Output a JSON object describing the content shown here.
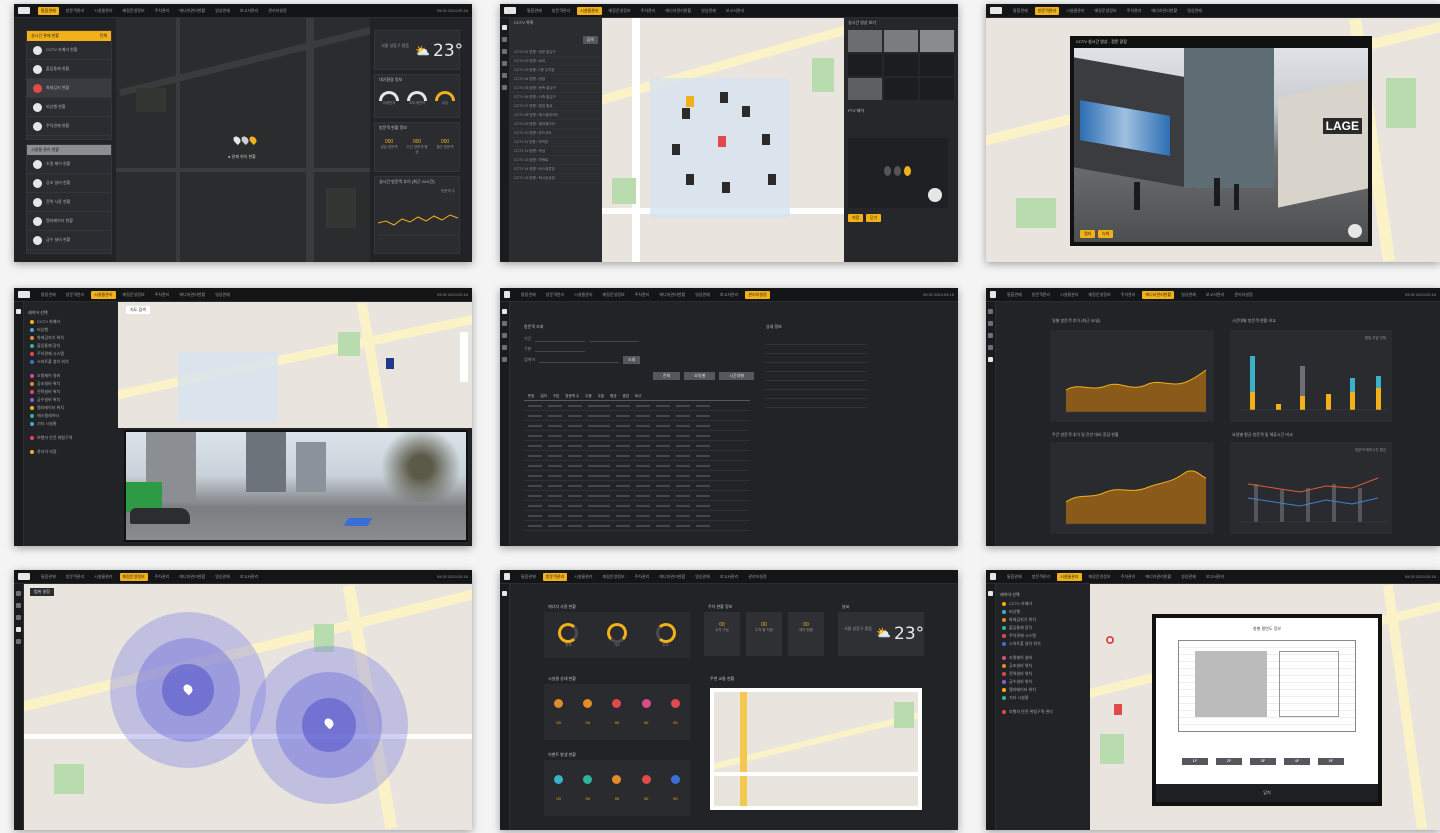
{
  "menu": [
    "통합관제",
    "방문객관리",
    "시설물관리",
    "매장운영정보",
    "주차관리",
    "에너지관리현황",
    "영상관제",
    "보고서관리",
    "관리자설정",
    "설정"
  ],
  "active_menu_index": 0,
  "top_right": "09:30 2024.05.16",
  "screen1": {
    "list1_header": "실시간 관제 현황",
    "list1_tag": "전체",
    "list1": [
      "CCTV 카메라 현황",
      "출입통제 현황",
      "화재감지 현황",
      "비상벨 현황",
      "주차관제 현황"
    ],
    "list2_header": "시설물 관리 현황",
    "list2": [
      "조명 제어 현황",
      "공조 설비 현황",
      "전력 사용 현황",
      "엘리베이터 현황",
      "급수 설비 현황"
    ],
    "map_label": "● 관제 위치 현황",
    "weather": {
      "label": "서울 성동구 맑음",
      "temp": "23°"
    },
    "gauge_title": "대기환경 정보",
    "gauges": [
      "미세먼지",
      "초미세먼지",
      "오존"
    ],
    "stats_title": "방문객 현황 정보",
    "stats": [
      {
        "value": "000",
        "label": "일일 방문객"
      },
      {
        "value": "000",
        "label": "주간 방문객 평균"
      },
      {
        "value": "000",
        "label": "월간 방문객"
      }
    ],
    "trend_title": "실시간 방문객 추이 (최근 24시간)",
    "trend_legend": "방문객 수"
  },
  "screen2": {
    "list_header": "CCTV 목록",
    "button": "검색",
    "rows": [
      "CCTV 01 방향 / 정문 출입구",
      "CCTV 02 방향 / 로비",
      "CCTV 03 방향 / 1층 주차장",
      "CCTV 04 방향 / 광장",
      "CCTV 05 방향 / 동측 출입구",
      "CCTV 06 방향 / 서측 출입구",
      "CCTV 07 방향 / 중앙 통로",
      "CCTV 08 방향 / 에스컬레이터",
      "CCTV 09 방향 / 엘리베이터",
      "CCTV 10 방향 / 푸드코트",
      "CCTV 11 방향 / 하역장",
      "CCTV 12 방향 / 옥상",
      "CCTV 13 방향 / 보행로",
      "CCTV 14 방향 / 버스정류장",
      "CCTV 15 방향 / 택시승강장"
    ],
    "video_title": "실시간 영상 보기",
    "control_title": "PTZ 제어",
    "buttons": [
      "저장",
      "닫기"
    ]
  },
  "screen3": {
    "popup_title": "CCTV 실시간 영상 - 정문 광장",
    "buttons": [
      "캡처",
      "녹화"
    ],
    "sign": "LAGE"
  },
  "screen4": {
    "panel_title": "레이어 선택",
    "group1": [
      "CCTV 카메라",
      "비상벨",
      "화재감지기 위치",
      "출입통제 장치",
      "주차관제 시스템",
      "스마트폴 설치 위치"
    ],
    "group2": [
      "조명제어 설비",
      "공조설비 위치",
      "전력설비 위치",
      "급수설비 위치",
      "엘리베이터 위치",
      "에스컬레이터",
      "기타 시설물"
    ],
    "group3": [
      "보행자 안전 위험구역"
    ],
    "group4": [
      "관리자 지정"
    ],
    "map_chip": "지도 검색"
  },
  "screen5": {
    "form_title": "방문객 조회",
    "filters": [
      "기간",
      "구분",
      "검색어"
    ],
    "search_button": "조회",
    "tabs": [
      "전체",
      "요일별",
      "시간대별"
    ],
    "detail_title": "상세 정보",
    "headers": [
      "번호",
      "일자",
      "구분",
      "방문객 수",
      "주중",
      "주말",
      "평균",
      "증감",
      "비고"
    ],
    "row_count": 13
  },
  "screen6": {
    "charts": [
      {
        "title": "일별 방문객 추이 (최근 30일)"
      },
      {
        "title": "시간대별 방문객 현황 비교"
      },
      {
        "title": "주간 방문객 추이 및 전년 대비 증감 현황"
      },
      {
        "title": "요일별 평균 방문객 및 체류시간 비교"
      }
    ],
    "legend_b": "평일  주말  전체",
    "legend_d": "방문객  체류시간  평균",
    "series_colors": {
      "fill": "#b7791f",
      "bar_a": "#f2b118",
      "bar_b": "#3bb0c9",
      "line_a": "#e05a3a",
      "line_b": "#3b82d6"
    }
  },
  "screen7": {
    "chip": "범위 설정"
  },
  "screen8": {
    "gauge_title": "에너지 사용 현황",
    "gauges": [
      "전력",
      "가스",
      "수도"
    ],
    "cards_title": "주차 현황 정보",
    "cards": [
      {
        "value": "00",
        "label": "주차 가능"
      },
      {
        "value": "00",
        "label": "주차 중 차량"
      },
      {
        "value": "00",
        "label": "예약 현황"
      }
    ],
    "weather_title": "날씨",
    "weather": {
      "label": "서울 성동구 맑음",
      "temp": "23°"
    },
    "icons_title1": "시설물 상태 현황",
    "icons_title2": "이벤트 발생 현황",
    "map_title": "주변 교통 현황",
    "icon_colors1": [
      "#e38a2a",
      "#e38a2a",
      "#e04a4a",
      "#d94c8a",
      "#e04a4a"
    ],
    "icon_colors2": [
      "#3bb0c9",
      "#2fb59a",
      "#e38a2a",
      "#e04a4a",
      "#3b6fd6"
    ],
    "icon_value": "00"
  },
  "screen9": {
    "panel_title": "레이어 선택",
    "group1": [
      "CCTV 카메라",
      "비상벨",
      "화재감지기 위치",
      "출입통제 장치",
      "주차관제 시스템",
      "스마트폴 설치 위치"
    ],
    "group2": [
      "조명제어 설비",
      "공조설비 위치",
      "전력설비 위치",
      "급수설비 위치",
      "엘리베이터 위치",
      "기타 시설물"
    ],
    "group3": [
      "보행자 안전 위험구역 관리"
    ],
    "popup_title": "층별 평면도 정보",
    "popup_buttons": [
      "1F",
      "2F",
      "3F",
      "4F",
      "5F"
    ],
    "popup_footer": "닫기"
  }
}
